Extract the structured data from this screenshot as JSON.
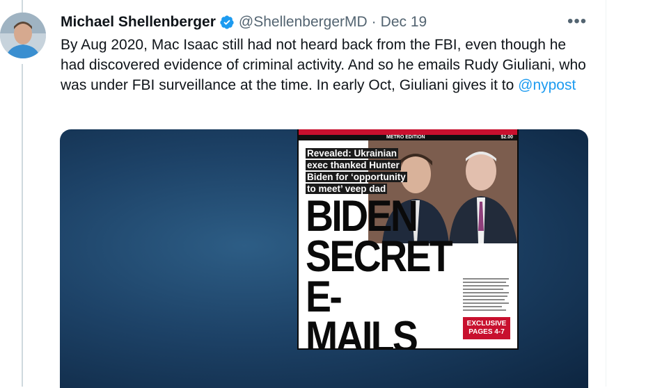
{
  "tweet": {
    "author_name": "Michael Shellenberger",
    "handle": "@ShellenbergerMD",
    "separator": "·",
    "date": "Dec 19",
    "more_label": "•••",
    "text_before_mention": "By Aug 2020, Mac Isaac still had not heard back from the FBI, even though he had discovered evidence of criminal activity. And so he emails Rudy Giuliani, who was under FBI surveillance at the time. In early Oct, Giuliani gives it to ",
    "mention": "@nypost"
  },
  "media": {
    "newspaper": {
      "edition": "METRO EDITION",
      "price": "$2.00",
      "subhead_lines": [
        "Revealed: Ukrainian",
        "exec thanked Hunter",
        "Biden for ‘opportunity",
        "to meet’ veep dad"
      ],
      "headline_lines": [
        "BIDEN",
        "SECRET",
        "E-MAILS"
      ],
      "exclusive_lines": [
        "EXCLUSIVE",
        "PAGES 4-7"
      ]
    }
  },
  "colors": {
    "link": "#1d9bf0",
    "verified": "#1d9bf0",
    "secondary_text": "#536471",
    "nypost_red": "#c8102e"
  },
  "icons": {
    "verified": "verified-badge-icon",
    "more": "more-options-icon"
  }
}
